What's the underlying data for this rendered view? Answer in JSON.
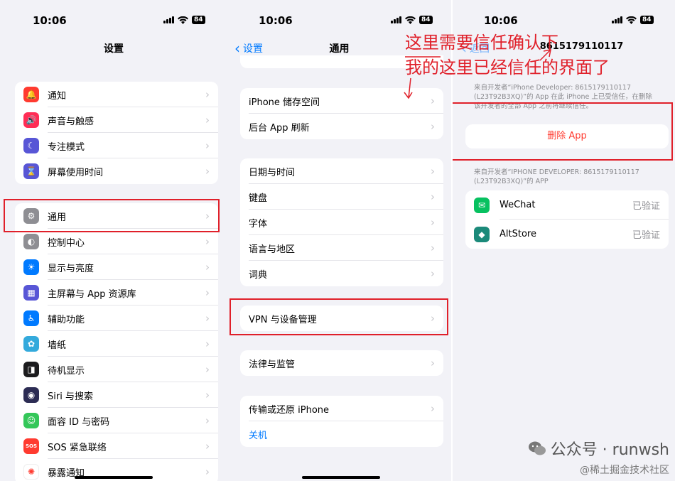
{
  "status": {
    "time": "10:06",
    "battery": "84"
  },
  "phone1": {
    "title": "设置",
    "groups": [
      [
        {
          "label": "通知",
          "icon": "bell-icon",
          "color": "#ff3b30",
          "glyph": "🔔"
        },
        {
          "label": "声音与触感",
          "icon": "speaker-icon",
          "color": "#ff2d55",
          "glyph": "🔊"
        },
        {
          "label": "专注模式",
          "icon": "moon-icon",
          "color": "#5856d6",
          "glyph": "☾"
        },
        {
          "label": "屏幕使用时间",
          "icon": "hourglass-icon",
          "color": "#5856d6",
          "glyph": "⌛"
        }
      ],
      [
        {
          "label": "通用",
          "icon": "gear-icon",
          "color": "#8e8e93",
          "glyph": "⚙"
        },
        {
          "label": "控制中心",
          "icon": "toggles-icon",
          "color": "#8e8e93",
          "glyph": "◐"
        },
        {
          "label": "显示与亮度",
          "icon": "sun-icon",
          "color": "#007aff",
          "glyph": "☀"
        },
        {
          "label": "主屏幕与 App 资源库",
          "icon": "homescreen-grid-icon",
          "color": "#5856d6",
          "glyph": "▦"
        },
        {
          "label": "辅助功能",
          "icon": "accessibility-icon",
          "color": "#007aff",
          "glyph": "♿"
        },
        {
          "label": "墙纸",
          "icon": "flower-icon",
          "color": "#34aadc",
          "glyph": "✿"
        },
        {
          "label": "待机显示",
          "icon": "standby-icon",
          "color": "#1c1c1e",
          "glyph": "◨"
        },
        {
          "label": "Siri 与搜索",
          "icon": "siri-icon",
          "color": "#2c2c54",
          "glyph": "◉"
        },
        {
          "label": "面容 ID 与密码",
          "icon": "faceid-icon",
          "color": "#34c759",
          "glyph": "☺"
        },
        {
          "label": "SOS 紧急联络",
          "icon": "sos-icon",
          "color": "#ff3b30",
          "glyph": "SOS"
        },
        {
          "label": "暴露通知",
          "icon": "exposure-icon",
          "color": "#ffffff",
          "glyph": "✺"
        }
      ]
    ]
  },
  "phone2": {
    "back": "设置",
    "title": "通用",
    "groups": [
      [
        "iPhone 储存空间",
        "后台 App 刷新"
      ],
      [
        "日期与时间",
        "键盘",
        "字体",
        "语言与地区",
        "词典"
      ],
      [
        "VPN 与设备管理"
      ],
      [
        "法律与监管"
      ],
      [
        "传输或还原 iPhone"
      ]
    ],
    "shutdown": "关机"
  },
  "phone3": {
    "back": "返回",
    "title": "8615179110117",
    "caption_top": "来自开发者“iPhone Developer: 8615179110117 (L23T92B3XQ)”的 App 在此 iPhone 上已受信任，在删除该开发者的全部 App 之前将继续信任。",
    "delete_label": "删除 App",
    "caption_apps": "来自开发者“IPHONE DEVELOPER: 8615179110117 (L23T92B3XQ)”的 APP",
    "apps": [
      {
        "name": "WeChat",
        "status": "已验证",
        "icon": "wechat-icon",
        "color": "#07c160"
      },
      {
        "name": "AltStore",
        "status": "已验证",
        "icon": "altstore-icon",
        "color": "#1b8a7a"
      }
    ]
  },
  "annotations": {
    "line1": "这里需要信任确认下",
    "line2": "我的这里已经信任的界面了"
  },
  "watermark": {
    "line1": "公众号 · runwsh",
    "line2": "@稀土掘金技术社区"
  },
  "colors": {
    "accent": "#007aff",
    "destructive": "#ff3b30",
    "annotation": "#e0202a"
  }
}
